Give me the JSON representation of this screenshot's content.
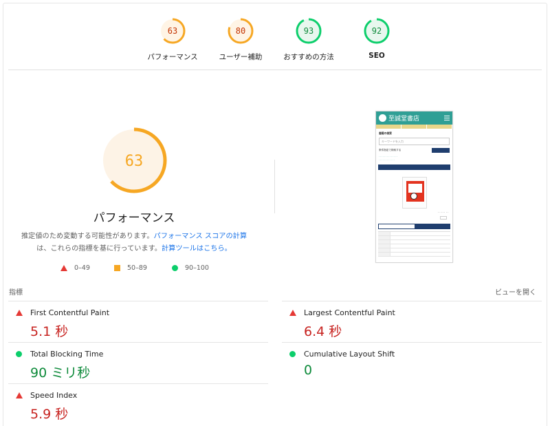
{
  "top_gauges": [
    {
      "score": "63",
      "label": "パフォーマンス",
      "color": "#f6a723",
      "fill": "#fff4e5",
      "text_color": "#c33300",
      "fraction": 0.63
    },
    {
      "score": "80",
      "label": "ユーザー補助",
      "color": "#f6a723",
      "fill": "#fff4e5",
      "text_color": "#c33300",
      "fraction": 0.8
    },
    {
      "score": "93",
      "label": "おすすめの方法",
      "color": "#0cce6b",
      "fill": "#e8f7ee",
      "text_color": "#0d8a3a",
      "fraction": 0.93
    },
    {
      "score": "92",
      "label": "SEO",
      "color": "#0cce6b",
      "fill": "#e8f7ee",
      "text_color": "#0d8a3a",
      "fraction": 0.92
    }
  ],
  "main": {
    "score": "63",
    "fraction": 0.63,
    "title": "パフォーマンス",
    "desc_line1_text": "推定値のため変動する可能性があります。",
    "desc_link1": "パフォーマンス スコアの計算",
    "desc_line2_text": "は、これらの指標を基に行っています。",
    "desc_link2": "計算ツールはこちら。",
    "legend": {
      "fail": "0–49",
      "average": "50–89",
      "pass": "90–100"
    }
  },
  "screenshot": {
    "site_title": "至誠堂書店",
    "search_label": "書籍の検索",
    "search_placeholder": "キーワードを入力",
    "row_label": "条件指定で検索する"
  },
  "metrics": {
    "header_left": "指標",
    "header_right": "ビューを開く",
    "items": [
      {
        "name": "First Contentful Paint",
        "value": "5.1 秒",
        "status": "fail"
      },
      {
        "name": "Largest Contentful Paint",
        "value": "6.4 秒",
        "status": "fail"
      },
      {
        "name": "Total Blocking Time",
        "value": "90 ミリ秒",
        "status": "pass"
      },
      {
        "name": "Cumulative Layout Shift",
        "value": "0",
        "status": "pass"
      },
      {
        "name": "Speed Index",
        "value": "5.9 秒",
        "status": "fail"
      }
    ]
  },
  "colors": {
    "fail": "#e53935",
    "average": "#f6a723",
    "pass": "#0cce6b",
    "link": "#1a73e8"
  }
}
